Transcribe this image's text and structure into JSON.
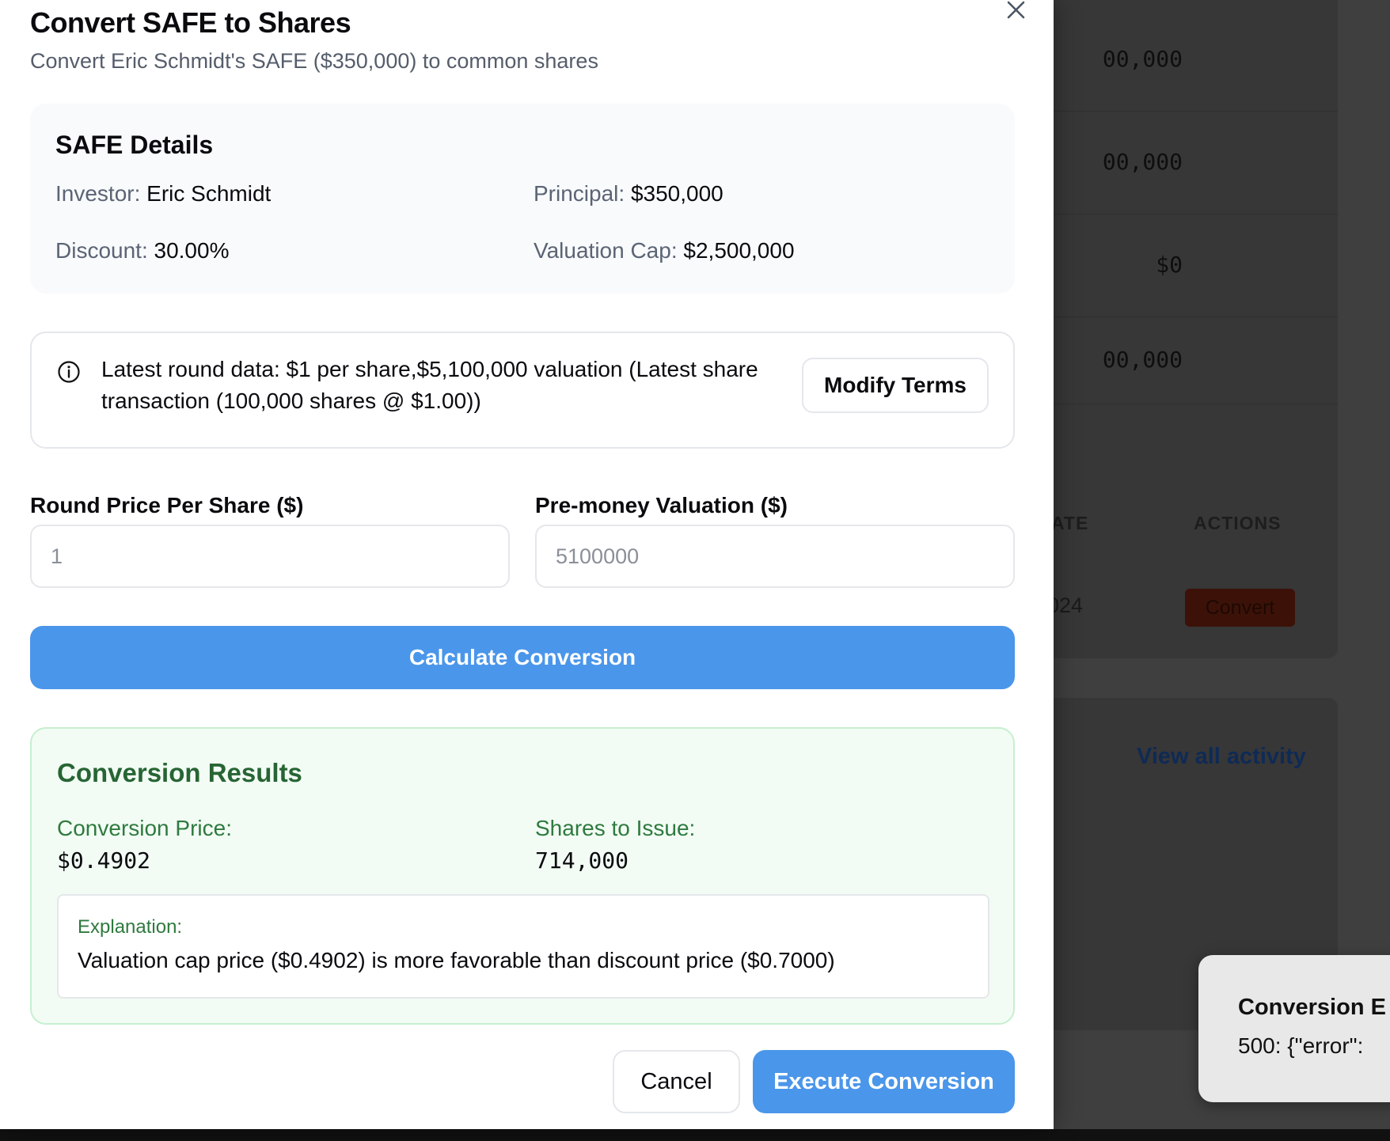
{
  "background": {
    "table_amounts": [
      "00,000",
      "00,000",
      "$0",
      "00,000"
    ],
    "col_date_header": "ATE",
    "col_actions_header": "ACTIONS",
    "row_date": "024",
    "convert_label": "Convert",
    "view_all_activity": "View all activity",
    "toast": {
      "title": "Conversion E",
      "message": "500: {\"error\":"
    }
  },
  "modal": {
    "title": "Convert SAFE to Shares",
    "subtitle": "Convert Eric Schmidt's SAFE ($350,000) to common shares",
    "close_icon": "close-icon",
    "details": {
      "heading": "SAFE Details",
      "investor_label": "Investor:",
      "investor_value": "Eric Schmidt",
      "principal_label": "Principal:",
      "principal_value": "$350,000",
      "discount_label": "Discount:",
      "discount_value": "30.00%",
      "cap_label": "Valuation Cap:",
      "cap_value": "$2,500,000"
    },
    "info": {
      "icon": "info-icon",
      "text": "Latest round data: $1 per share,$5,100,000 valuation (Latest share transaction (100,000 shares @ $1.00))",
      "modify_label": "Modify Terms"
    },
    "form": {
      "price_label": "Round Price Per Share ($)",
      "price_placeholder": "1",
      "valuation_label": "Pre-money Valuation ($)",
      "valuation_placeholder": "5100000",
      "calculate_label": "Calculate Conversion"
    },
    "results": {
      "heading": "Conversion Results",
      "price_label": "Conversion Price:",
      "price_value": "$0.4902",
      "shares_label": "Shares to Issue:",
      "shares_value": "714,000",
      "explanation_label": "Explanation:",
      "explanation_text": "Valuation cap price ($0.4902) is more favorable than discount price ($0.7000)"
    },
    "actions": {
      "cancel_label": "Cancel",
      "execute_label": "Execute Conversion"
    },
    "colors": {
      "primary": "#4a96ea",
      "success_text": "#276534",
      "success_bg": "#f2fcf4"
    }
  }
}
